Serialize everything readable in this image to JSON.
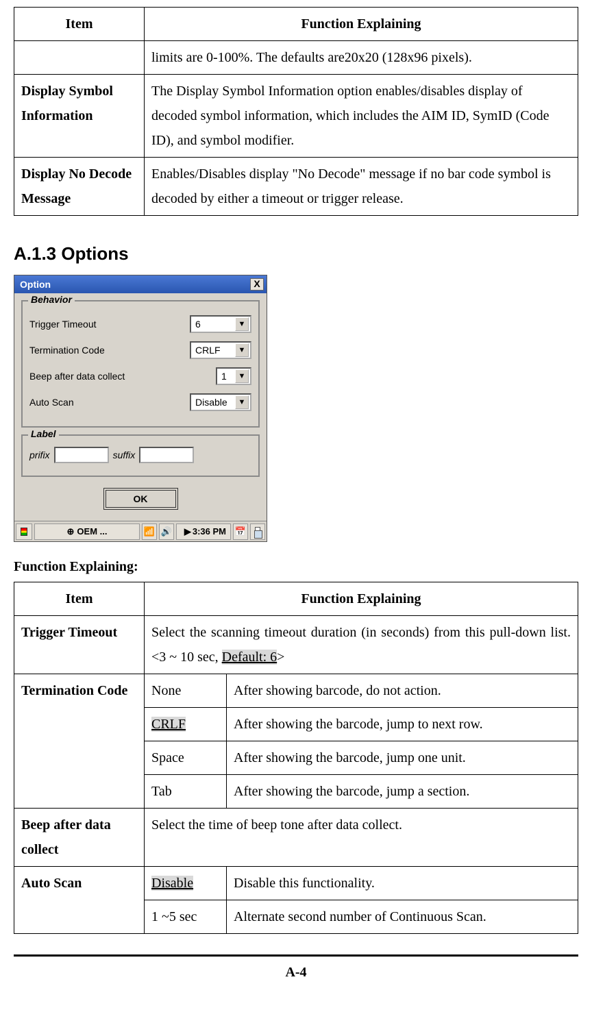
{
  "table1": {
    "headers": {
      "item": "Item",
      "explain": "Function Explaining"
    },
    "rows": [
      {
        "item": "",
        "explain": "limits are 0-100%. The defaults are20x20 (128x96 pixels)."
      },
      {
        "item": "Display Symbol Information",
        "explain": "The Display Symbol Information option enables/disables display of decoded symbol information, which includes the AIM ID, SymID (Code ID), and symbol modifier."
      },
      {
        "item": "Display No Decode Message",
        "explain": "Enables/Disables display \"No Decode\" message if no bar code symbol is decoded by either a timeout or trigger release."
      }
    ]
  },
  "section_heading": "A.1.3 Options",
  "dialog": {
    "title": "Option",
    "close": "X",
    "behavior_legend": "Behavior",
    "label_legend": "Label",
    "trigger_timeout_label": "Trigger Timeout",
    "trigger_timeout_value": "6",
    "termination_code_label": "Termination Code",
    "termination_code_value": "CRLF",
    "beep_label": "Beep after data collect",
    "beep_value": "1",
    "auto_scan_label": "Auto Scan",
    "auto_scan_value": "Disable",
    "prefix_label": "prifix",
    "suffix_label": "suffix",
    "ok": "OK",
    "taskbar_oem": "OEM ...",
    "taskbar_time": "3:36 PM"
  },
  "func_label": "Function Explaining:",
  "table2": {
    "headers": {
      "item": "Item",
      "explain": "Function Explaining"
    },
    "trigger_timeout": {
      "item": "Trigger Timeout",
      "explain_pre": "Select the scanning timeout duration (in seconds) from this pull-down list. <3 ~ 10 sec, ",
      "explain_hl": "Default: 6",
      "explain_post": ">"
    },
    "termination": {
      "item": "Termination Code",
      "rows": [
        {
          "code": "None",
          "hl": false,
          "desc": "After showing barcode, do not action."
        },
        {
          "code": "CRLF",
          "hl": true,
          "desc": "After showing the barcode, jump to next row."
        },
        {
          "code": "Space",
          "hl": false,
          "desc": "After showing the barcode, jump one unit."
        },
        {
          "code": "Tab",
          "hl": false,
          "desc": "After showing the barcode, jump a section."
        }
      ]
    },
    "beep": {
      "item": "Beep after data collect",
      "explain": "Select the time of beep tone after data collect."
    },
    "autoscan": {
      "item": "Auto Scan",
      "rows": [
        {
          "code": "Disable",
          "hl": true,
          "desc": "Disable this functionality."
        },
        {
          "code": "1 ~5 sec",
          "hl": false,
          "desc": "Alternate second number of Continuous Scan."
        }
      ]
    }
  },
  "page_number": "A-4"
}
